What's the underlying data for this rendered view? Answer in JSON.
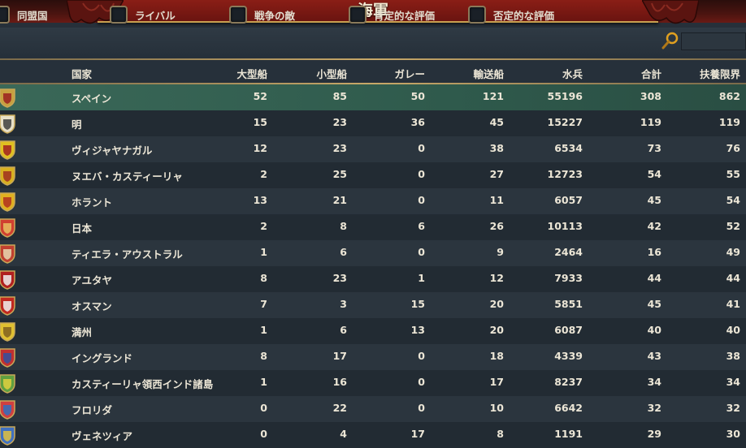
{
  "window": {
    "title": "海軍"
  },
  "filters": [
    {
      "label": "同盟国"
    },
    {
      "label": "ライバル"
    },
    {
      "label": "戦争の敵"
    },
    {
      "label": "肯定的な評価"
    },
    {
      "label": "否定的な評価"
    }
  ],
  "search": {
    "value": ""
  },
  "columns": [
    "国家",
    "大型船",
    "小型船",
    "ガレー",
    "輸送船",
    "水兵",
    "合計",
    "扶養限界"
  ],
  "rows": [
    {
      "country": "スペイン",
      "heavy": "52",
      "light": "85",
      "galley": "50",
      "transport": "121",
      "sailors": "55196",
      "total": "308",
      "limit": "862",
      "shield_color": "#c8a040",
      "emblem_color": "#9a2020"
    },
    {
      "country": "明",
      "heavy": "15",
      "light": "23",
      "galley": "36",
      "transport": "45",
      "sailors": "15227",
      "total": "119",
      "limit": "119",
      "shield_color": "#e8e0c8",
      "emblem_color": "#404040"
    },
    {
      "country": "ヴィジャヤナガル",
      "heavy": "12",
      "light": "23",
      "galley": "0",
      "transport": "38",
      "sailors": "6534",
      "total": "73",
      "limit": "76",
      "shield_color": "#e0c020",
      "emblem_color": "#a02020"
    },
    {
      "country": "ヌエバ・カスティーリャ",
      "heavy": "2",
      "light": "25",
      "galley": "0",
      "transport": "27",
      "sailors": "12723",
      "total": "54",
      "limit": "55",
      "shield_color": "#d8b020",
      "emblem_color": "#a03020"
    },
    {
      "country": "ホラント",
      "heavy": "13",
      "light": "21",
      "galley": "0",
      "transport": "11",
      "sailors": "6057",
      "total": "45",
      "limit": "54",
      "shield_color": "#e0b020",
      "emblem_color": "#b03020"
    },
    {
      "country": "日本",
      "heavy": "2",
      "light": "8",
      "galley": "6",
      "transport": "26",
      "sailors": "10113",
      "total": "42",
      "limit": "52",
      "shield_color": "#d04030",
      "emblem_color": "#e8c060"
    },
    {
      "country": "ティエラ・アウストラル",
      "heavy": "1",
      "light": "6",
      "galley": "0",
      "transport": "9",
      "sailors": "2464",
      "total": "16",
      "limit": "49",
      "shield_color": "#c04030",
      "emblem_color": "#e8d8b0"
    },
    {
      "country": "アユタヤ",
      "heavy": "8",
      "light": "23",
      "galley": "1",
      "transport": "12",
      "sailors": "7933",
      "total": "44",
      "limit": "44",
      "shield_color": "#b02020",
      "emblem_color": "#f0f0f0"
    },
    {
      "country": "オスマン",
      "heavy": "7",
      "light": "3",
      "galley": "15",
      "transport": "20",
      "sailors": "5851",
      "total": "45",
      "limit": "41",
      "shield_color": "#c02820",
      "emblem_color": "#f0f0f0"
    },
    {
      "country": "満州",
      "heavy": "1",
      "light": "6",
      "galley": "13",
      "transport": "20",
      "sailors": "6087",
      "total": "40",
      "limit": "40",
      "shield_color": "#e0c030",
      "emblem_color": "#806020"
    },
    {
      "country": "イングランド",
      "heavy": "8",
      "light": "17",
      "galley": "0",
      "transport": "18",
      "sailors": "4339",
      "total": "43",
      "limit": "38",
      "shield_color": "#c03030",
      "emblem_color": "#3050a0"
    },
    {
      "country": "カスティーリャ領西インド諸島",
      "heavy": "1",
      "light": "16",
      "galley": "0",
      "transport": "17",
      "sailors": "8237",
      "total": "34",
      "limit": "34",
      "shield_color": "#60a040",
      "emblem_color": "#e0d040"
    },
    {
      "country": "フロリダ",
      "heavy": "0",
      "light": "22",
      "galley": "0",
      "transport": "10",
      "sailors": "6642",
      "total": "32",
      "limit": "32",
      "shield_color": "#d04040",
      "emblem_color": "#3070c0"
    },
    {
      "country": "ヴェネツィア",
      "heavy": "0",
      "light": "4",
      "galley": "17",
      "transport": "8",
      "sailors": "1191",
      "total": "29",
      "limit": "30",
      "shield_color": "#4070c0",
      "emblem_color": "#e0c040"
    }
  ]
}
